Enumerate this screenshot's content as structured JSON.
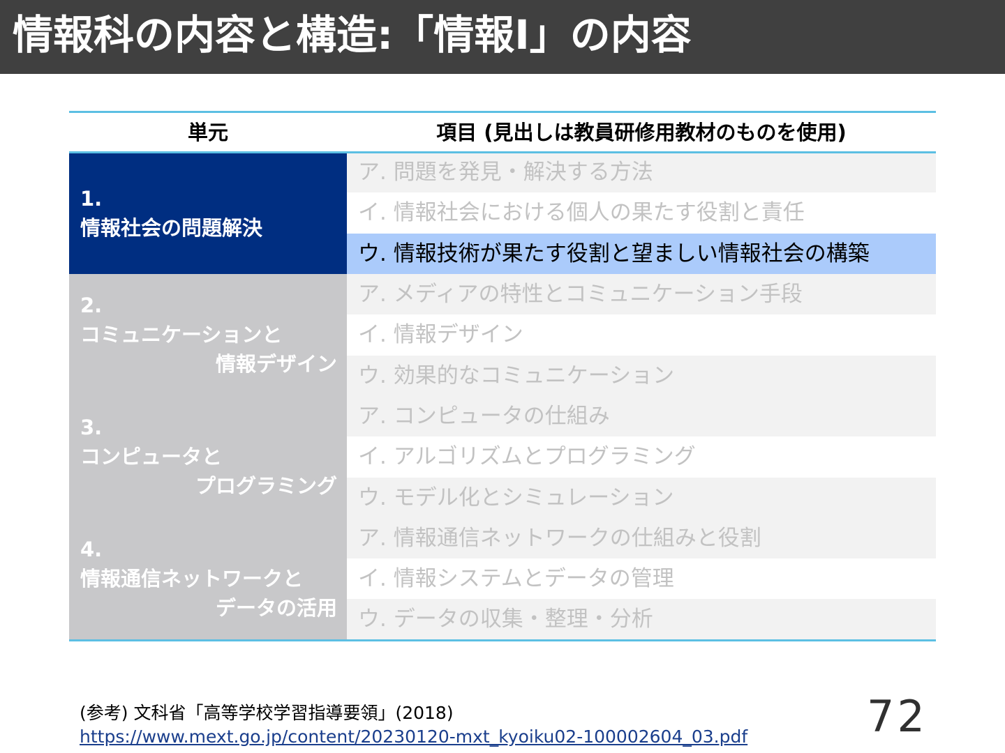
{
  "title": "情報科の内容と構造:「情報I」の内容",
  "table": {
    "header_unit": "単元",
    "header_items": "項目 (見出しは教員研修用教材のものを使用)",
    "units": [
      {
        "num": "1.",
        "line1": "情報社会の問題解決",
        "line2": "",
        "active": true
      },
      {
        "num": "2.",
        "line1": "コミュニケーションと",
        "line2": "情報デザイン",
        "active": false
      },
      {
        "num": "3.",
        "line1": "コンピュータと",
        "line2": "プログラミング",
        "active": false
      },
      {
        "num": "4.",
        "line1": "情報通信ネットワークと",
        "line2": "データの活用",
        "active": false
      }
    ],
    "items": [
      "ア. 問題を発見・解決する方法",
      "イ. 情報社会における個人の果たす役割と責任",
      "ウ. 情報技術が果たす役割と望ましい情報社会の構築",
      "ア. メディアの特性とコミュニケーション手段",
      "イ. 情報デザイン",
      "ウ. 効果的なコミュニケーション",
      "ア. コンピュータの仕組み",
      "イ. アルゴリズムとプログラミング",
      "ウ. モデル化とシミュレーション",
      "ア. 情報通信ネットワークの仕組みと役割",
      "イ. 情報システムとデータの管理",
      "ウ. データの収集・整理・分析"
    ],
    "selected_item_index": 2
  },
  "reference": "(参考) 文科省「高等学校学習指導要領」(2018)",
  "url": "https://www.mext.go.jp/content/20230120-mxt_kyoiku02-100002604_03.pdf",
  "page_number": "72",
  "colors": {
    "title_bar": "#404040",
    "active_unit": "#002e81",
    "inactive_unit": "#c8c8ca",
    "selected_row": "#abcbfb",
    "rule": "#5cbfe3"
  }
}
